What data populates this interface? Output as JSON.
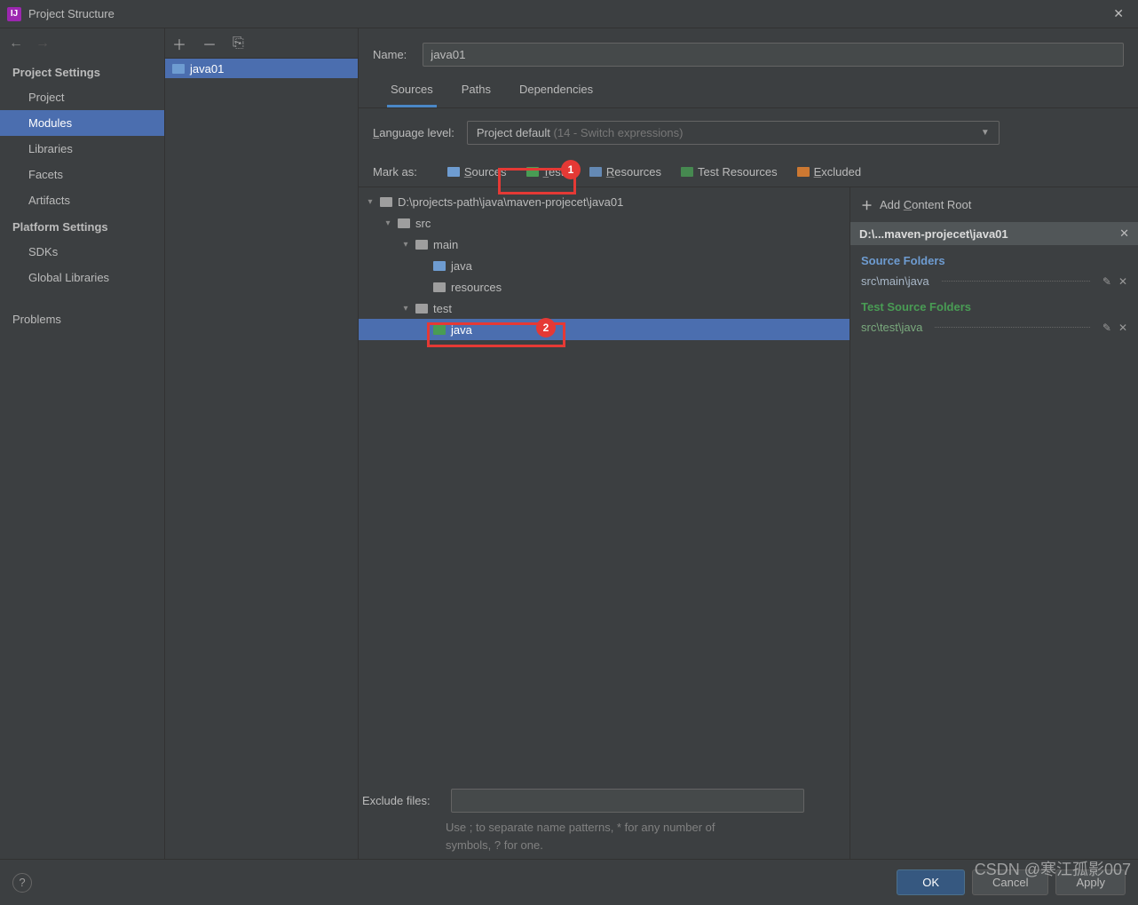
{
  "window": {
    "title": "Project Structure"
  },
  "nav": {
    "section1_header": "Project Settings",
    "section1_items": [
      {
        "label": "Project"
      },
      {
        "label": "Modules",
        "selected": true
      },
      {
        "label": "Libraries"
      },
      {
        "label": "Facets"
      },
      {
        "label": "Artifacts"
      }
    ],
    "section2_header": "Platform Settings",
    "section2_items": [
      {
        "label": "SDKs"
      },
      {
        "label": "Global Libraries"
      }
    ],
    "section3_items": [
      {
        "label": "Problems"
      }
    ]
  },
  "modules": {
    "items": [
      {
        "label": "java01",
        "selected": true
      }
    ]
  },
  "detail": {
    "name_label": "Name:",
    "name_value": "java01",
    "tabs": [
      {
        "label": "Sources",
        "active": true
      },
      {
        "label": "Paths"
      },
      {
        "label": "Dependencies"
      }
    ],
    "lang_label": "Language level:",
    "lang_value_main": "Project default",
    "lang_value_hint": " (14 - Switch expressions)",
    "markas_label": "Mark as:",
    "markas_buttons": {
      "sources": "Sources",
      "tests": "Tests",
      "resources": "Resources",
      "test_resources": "Test Resources",
      "excluded": "Excluded"
    },
    "tree": [
      {
        "ind": 0,
        "chev": "▾",
        "icon": "gray",
        "label": "D:\\projects-path\\java\\maven-projecet\\java01"
      },
      {
        "ind": 1,
        "chev": "▾",
        "icon": "gray",
        "label": "src"
      },
      {
        "ind": 2,
        "chev": "▾",
        "icon": "gray",
        "label": "main"
      },
      {
        "ind": 3,
        "chev": "",
        "icon": "blue",
        "label": "java"
      },
      {
        "ind": 3,
        "chev": "",
        "icon": "gray",
        "label": "resources"
      },
      {
        "ind": 2,
        "chev": "▾",
        "icon": "gray",
        "label": "test"
      },
      {
        "ind": 3,
        "chev": "",
        "icon": "green",
        "label": "java",
        "selected": true
      }
    ],
    "roots": {
      "add_label": "Add Content Root",
      "cr_path": "D:\\...maven-projecet\\java01",
      "source_title": "Source Folders",
      "source_items": [
        {
          "path": "src\\main\\java"
        }
      ],
      "test_title": "Test Source Folders",
      "test_items": [
        {
          "path": "src\\test\\java"
        }
      ]
    },
    "exclude_label": "Exclude files:",
    "exclude_value": "",
    "exclude_hint1": "Use ; to separate name patterns, * for any number of",
    "exclude_hint2": "symbols, ? for one."
  },
  "footer": {
    "ok": "OK",
    "cancel": "Cancel",
    "apply": "Apply"
  },
  "annotations": {
    "tests_badge": "1",
    "java_badge": "2"
  },
  "watermark": "CSDN @寒江孤影007"
}
